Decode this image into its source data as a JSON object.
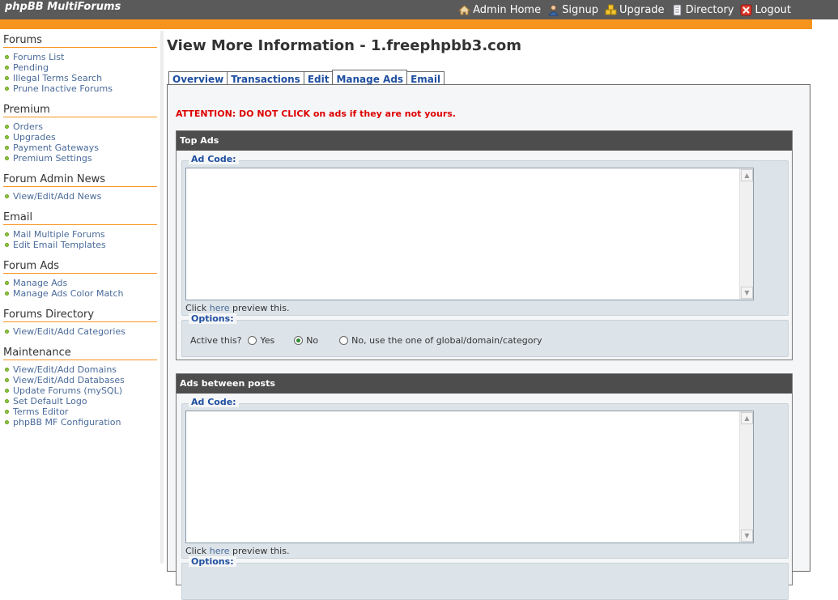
{
  "header": {
    "brand": "phpBB MultiForums",
    "nav": [
      {
        "label": "Admin Home",
        "icon": "home-icon"
      },
      {
        "label": "Signup",
        "icon": "user-icon"
      },
      {
        "label": "Upgrade",
        "icon": "upgrade-icon"
      },
      {
        "label": "Directory",
        "icon": "directory-icon"
      },
      {
        "label": "Logout",
        "icon": "logout-icon"
      }
    ]
  },
  "sidebar": {
    "sections": [
      {
        "title": "Forums",
        "items": [
          "Forums List",
          "Pending",
          "Illegal Terms Search",
          "Prune Inactive Forums"
        ]
      },
      {
        "title": "Premium",
        "items": [
          "Orders",
          "Upgrades",
          "Payment Gateways",
          "Premium Settings"
        ]
      },
      {
        "title": "Forum Admin News",
        "items": [
          "View/Edit/Add News"
        ]
      },
      {
        "title": "Email",
        "items": [
          "Mail Multiple Forums",
          "Edit Email Templates"
        ]
      },
      {
        "title": "Forum Ads",
        "items": [
          "Manage Ads",
          "Manage Ads Color Match"
        ]
      },
      {
        "title": "Forums Directory",
        "items": [
          "View/Edit/Add Categories"
        ]
      },
      {
        "title": "Maintenance",
        "items": [
          "View/Edit/Add Domains",
          "View/Edit/Add Databases",
          "Update Forums (mySQL)",
          "Set Default Logo",
          "Terms Editor",
          "phpBB MF Configuration"
        ]
      }
    ]
  },
  "main": {
    "title": "View More Information - 1.freephpbb3.com",
    "tabs": [
      {
        "label": "Overview",
        "active": false
      },
      {
        "label": "Transactions",
        "active": false
      },
      {
        "label": "Edit",
        "active": false
      },
      {
        "label": "Manage Ads",
        "active": true
      },
      {
        "label": "Email",
        "active": false
      }
    ],
    "attention": "ATTENTION: DO NOT CLICK on ads if they are not yours.",
    "panels": [
      {
        "title": "Top Ads",
        "ad_code_legend": "Ad Code:",
        "ad_code_value": "",
        "click_prefix": "Click",
        "click_link": "here",
        "click_suffix": "preview this.",
        "options_legend": "Options:",
        "active_label": "Active this?",
        "radio_yes": "Yes",
        "radio_no": "No",
        "radio_global": "No, use the one of global/domain/category",
        "selected": "No"
      },
      {
        "title": "Ads between posts",
        "ad_code_legend": "Ad Code:",
        "ad_code_value": "",
        "click_prefix": "Click",
        "click_link": "here",
        "click_suffix": "preview this.",
        "options_legend": "Options:"
      }
    ]
  },
  "colors": {
    "header_bg": "#5a5a5a",
    "accent_orange": "#f7941d",
    "panel_head_bg": "#4d4d4d",
    "link_blue": "#1f4fa0",
    "attention_red": "#dd0000"
  }
}
